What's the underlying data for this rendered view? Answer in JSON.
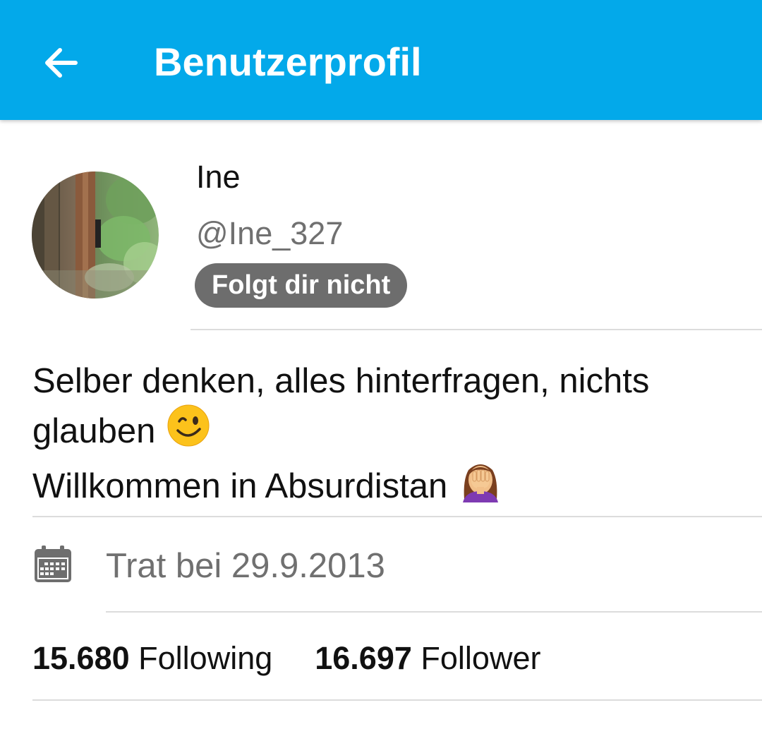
{
  "app_bar": {
    "title": "Benutzerprofil",
    "background_color": "#03A9EA",
    "back_icon": "arrow-back-icon"
  },
  "profile": {
    "display_name": "Ine",
    "handle": "@Ine_327",
    "follow_status": "Folgt dir nicht",
    "avatar_icon": "forest-photo-avatar"
  },
  "bio": {
    "line1": "Selber denken, alles hinterfragen, nichts",
    "line2": "glauben",
    "line2_emoji": "winking-face-emoji",
    "line3": "Willkommen in Absurdistan",
    "line3_emoji": "woman-facepalming-emoji"
  },
  "joined": {
    "icon": "calendar-icon",
    "text": "Trat bei 29.9.2013"
  },
  "stats": {
    "following_count": "15.680",
    "following_label": "Following",
    "follower_count": "16.697",
    "follower_label": "Follower"
  }
}
